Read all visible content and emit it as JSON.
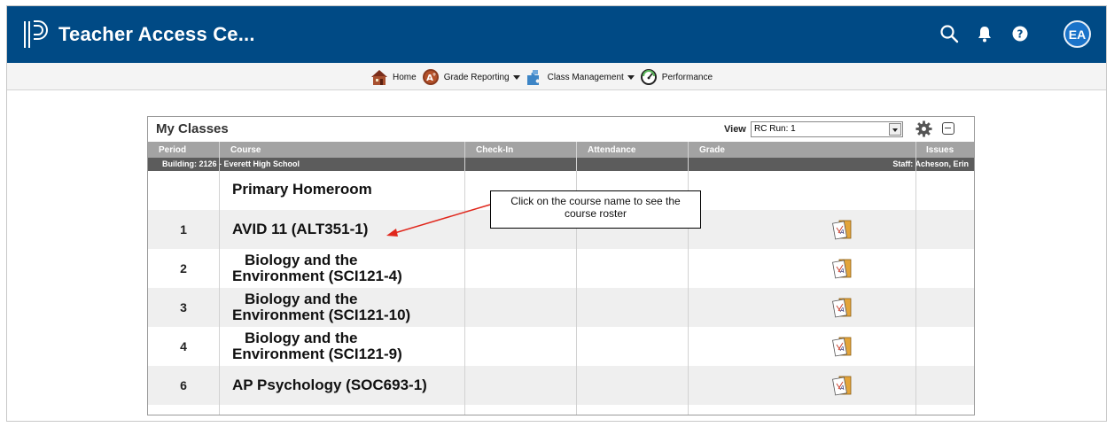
{
  "header": {
    "title": "Teacher Access Ce...",
    "avatar_initials": "EA",
    "bar_color": "#004a85",
    "icons": [
      "powerschool-logo-icon",
      "search-icon",
      "bell-icon",
      "help-icon"
    ]
  },
  "nav": {
    "items": [
      {
        "label": "Home",
        "icon": "home-icon"
      },
      {
        "label": "Grade Reporting",
        "icon": "grade-reporting-icon"
      },
      {
        "label": "Class Management",
        "icon": "class-management-icon"
      },
      {
        "label": "Performance",
        "icon": "performance-icon"
      }
    ]
  },
  "panel": {
    "title": "My Classes",
    "view_label": "View",
    "view_value": "RC Run: 1",
    "columns": [
      "Period",
      "Course",
      "Check-In",
      "Attendance",
      "Grade",
      "Issues"
    ],
    "building": "Building: 2126 - Everett High School",
    "staff": "Staff: Acheson, Erin",
    "rows": [
      {
        "period": "",
        "course": "Primary Homeroom",
        "has_grade": false
      },
      {
        "period": "1",
        "course": "AVID 11 (ALT351-1)",
        "has_grade": true
      },
      {
        "period": "2",
        "course_line1": "Biology and the",
        "course_line2": "Environment (SCI121-4)",
        "has_grade": true
      },
      {
        "period": "3",
        "course_line1": "Biology and the",
        "course_line2": "Environment (SCI121-10)",
        "has_grade": true
      },
      {
        "period": "4",
        "course_line1": "Biology and the",
        "course_line2": "Environment (SCI121-9)",
        "has_grade": true
      },
      {
        "period": "6",
        "course": "AP Psychology (SOC693-1)",
        "has_grade": true
      }
    ]
  },
  "callout": {
    "line1": "Click on the course name to see the",
    "line2": "course roster",
    "arrow_color": "#e0271c"
  }
}
